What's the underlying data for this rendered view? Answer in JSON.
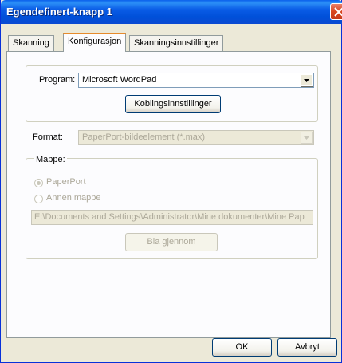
{
  "window": {
    "title": "Egendefinert-knapp 1"
  },
  "tabs": [
    {
      "label": "Skanning"
    },
    {
      "label": "Konfigurasjon"
    },
    {
      "label": "Skanningsinnstillinger"
    }
  ],
  "program": {
    "label": "Program:",
    "value": "Microsoft WordPad",
    "settings_button": "Koblingsinnstillinger"
  },
  "format": {
    "label": "Format:",
    "value": "PaperPort-bildeelement (*.max)"
  },
  "folder": {
    "group_label": "Mappe:",
    "option_paperport": "PaperPort",
    "option_other": "Annen mappe",
    "path": "E:\\Documents and Settings\\Administrator\\Mine dokumenter\\Mine Pap",
    "browse_button": "Bla gjennom"
  },
  "footer": {
    "ok": "OK",
    "cancel": "Avbryt"
  }
}
